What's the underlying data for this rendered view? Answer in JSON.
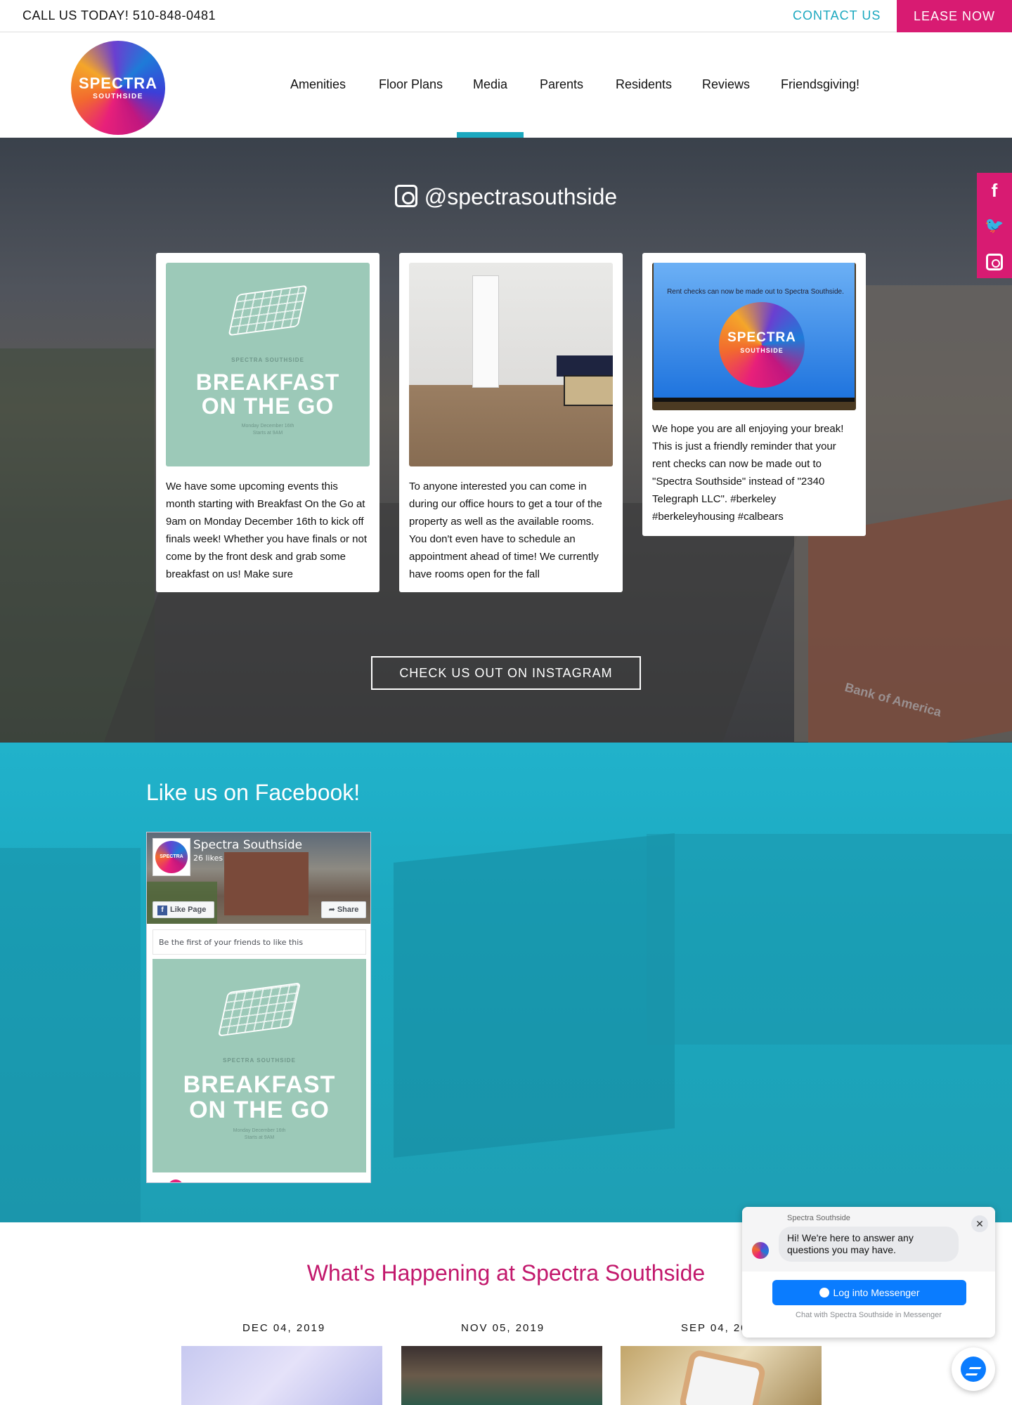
{
  "topbar": {
    "phone": "CALL US TODAY! 510-848-0481",
    "contact": "CONTACT US",
    "lease": "LEASE NOW"
  },
  "logo": {
    "line1": "SPECTRA",
    "line2": "SOUTHSIDE"
  },
  "nav": {
    "items": [
      "Amenities",
      "Floor Plans",
      "Media",
      "Parents",
      "Residents",
      "Reviews",
      "Friendsgiving!"
    ],
    "active": "Media"
  },
  "instagram": {
    "handle": "@spectrasouthside",
    "posts": [
      {
        "text": "We have some upcoming events this month starting with Breakfast On the Go at 9am on Monday December 16th to kick off finals week! Whether you have finals or not come by the front desk and grab some breakfast on us! Make sure"
      },
      {
        "text": "To anyone interested you can come in during our office hours to get a tour of the property as well as the available rooms. You don't even have to schedule an appointment ahead of time! We currently have rooms open for the fall"
      },
      {
        "text": "We hope you are all enjoying your break! This is just a friendly reminder that your rent checks can now be made out to \"Spectra Southside\" instead of \"2340 Telegraph LLC\". #berkeley #berkeleyhousing #calbears"
      }
    ],
    "flyer": {
      "brand": "SPECTRA SOUTHSIDE",
      "line1": "BREAKFAST",
      "line2": "ON THE GO",
      "date": "Monday December 16th",
      "time": "Starts at 9AM"
    },
    "tv_note": "Rent checks can now be made out to Spectra Southside.",
    "tv_logo": {
      "line1": "SPECTRA",
      "line2": "SOUTHSIDE"
    },
    "button": "CHECK US OUT ON INSTAGRAM",
    "bank_sign": "Bank of America"
  },
  "social": {
    "facebook": "f",
    "twitter": "🐦",
    "instagram": "instagram"
  },
  "facebook": {
    "title": "Like us on Facebook!",
    "page_name": "Spectra Southside",
    "likes": "26 likes",
    "avatar_text": "SPECTRA",
    "like_btn": "Like Page",
    "share_btn": "Share",
    "friends": "Be the first of your friends to like this"
  },
  "happening": {
    "title": "What's Happening at Spectra Southside",
    "dates": [
      "DEC 04, 2019",
      "NOV 05, 2019",
      "SEP 04, 2019"
    ]
  },
  "chat": {
    "page_name": "Spectra Southside",
    "message": "Hi! We're here to answer any questions you may have.",
    "close": "✕",
    "login": "Log into Messenger",
    "footer": "Chat with Spectra Southside in Messenger"
  },
  "colors": {
    "accent_pink": "#d81b72",
    "accent_teal": "#1ba8bf",
    "messenger_blue": "#0a7cff"
  },
  "icons": [
    "instagram-icon",
    "facebook-icon",
    "twitter-icon",
    "messenger-icon",
    "close-icon"
  ]
}
